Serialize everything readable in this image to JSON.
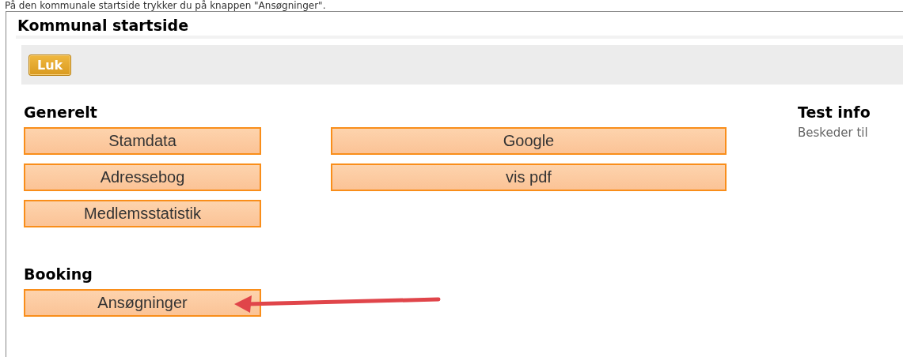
{
  "caption": "På den kommunale startside trykker du på knappen \"Ansøgninger\".",
  "window": {
    "title": "Kommunal startside"
  },
  "toolbar": {
    "buttons": [
      "Luk"
    ]
  },
  "sections": [
    {
      "title": "Generelt",
      "columns": [
        [
          "Stamdata",
          "Adressebog",
          "Medlemsstatistik"
        ],
        [
          "Google",
          "vis pdf"
        ]
      ]
    },
    {
      "title": "Booking",
      "columns": [
        [
          "Ansøgninger"
        ]
      ]
    }
  ],
  "side_panel": {
    "title": "Test info",
    "text": "Beskeder til"
  },
  "annotation": {
    "kind": "arrow"
  }
}
